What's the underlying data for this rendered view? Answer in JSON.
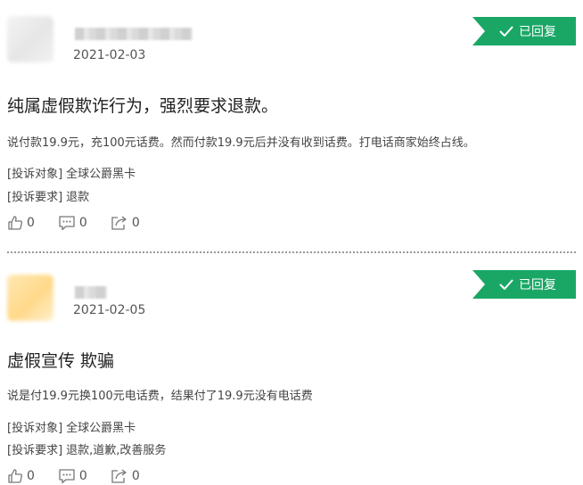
{
  "complaints": [
    {
      "date": "2021-02-03",
      "status": "已回复",
      "title": "纯属虚假欺诈行为，强烈要求退款。",
      "description": "说付款19.9元，充100元话费。然而付款19.9元后并没有收到话费。打电话商家始终占线。",
      "target_label": "[投诉对象]",
      "target_value": "全球公爵黑卡",
      "request_label": "[投诉要求]",
      "request_value": "退款",
      "likes": "0",
      "comments": "0",
      "shares": "0"
    },
    {
      "date": "2021-02-05",
      "status": "已回复",
      "title": "虚假宣传 欺骗",
      "description": "说是付19.9元换100元电话费，结果付了19.9元没有电话费",
      "target_label": "[投诉对象]",
      "target_value": "全球公爵黑卡",
      "request_label": "[投诉要求]",
      "request_value": "退款,道歉,改善服务",
      "likes": "0",
      "comments": "0",
      "shares": "0"
    }
  ],
  "colors": {
    "badge": "#1aa766",
    "divider": "#9a9a9a"
  },
  "icons": [
    "check-icon",
    "thumbs-up-icon",
    "comment-icon",
    "share-icon"
  ]
}
